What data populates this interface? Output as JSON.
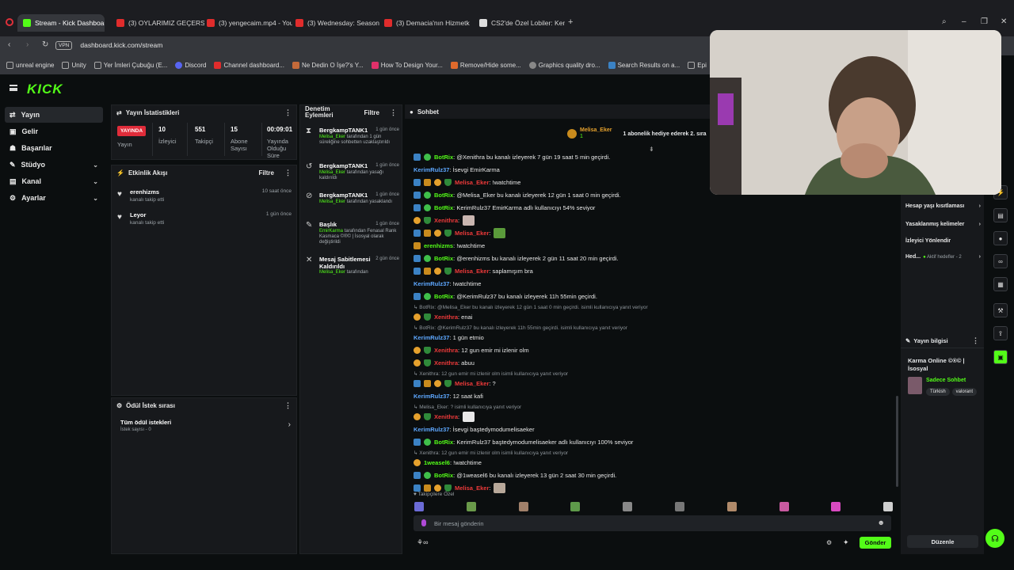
{
  "browser": {
    "tabs": [
      {
        "label": "Stream - Kick Dashboard",
        "active": true,
        "icon": "kick-icon"
      },
      {
        "label": "(3) OYLARIMIZ GEÇERSİZ",
        "icon": "youtube-icon"
      },
      {
        "label": "(3) yengecaim.mp4 - YouT",
        "icon": "youtube-icon"
      },
      {
        "label": "(3) Wednesday: Season 2",
        "icon": "youtube-icon"
      },
      {
        "label": "(3) Demacia'nın Hizmetkâ",
        "icon": "youtube-icon"
      },
      {
        "label": "CS2'de Özel Lobiler: Kend",
        "icon": "cs2-icon"
      }
    ],
    "vpn_label": "VPN",
    "url": "dashboard.kick.com/stream",
    "bookmarks": [
      "unreal engine",
      "Unity",
      "Yer İmleri Çubuğu (E...",
      "Discord",
      "Channel dashboard...",
      "Ne Dedin O İşe?'s Y...",
      "How To Design Your...",
      "Remove/Hide some...",
      "Graphics quality dro...",
      "Search Results on a...",
      "Epi"
    ]
  },
  "brand": {
    "logo": "KICK",
    "accent": "#53fc18"
  },
  "sidenav": {
    "items": [
      {
        "label": "Yayın",
        "icon": "broadcast-icon",
        "selected": true
      },
      {
        "label": "Gelir",
        "icon": "wallet-icon"
      },
      {
        "label": "Başarılar",
        "icon": "trophy-icon"
      },
      {
        "label": "Stüdyo",
        "icon": "studio-icon",
        "expandable": true
      },
      {
        "label": "Kanal",
        "icon": "channel-icon",
        "expandable": true
      },
      {
        "label": "Ayarlar",
        "icon": "gear-icon",
        "expandable": true
      }
    ]
  },
  "stats": {
    "title": "Yayın İstatistikleri",
    "live_badge": "YAYINDA",
    "live_label": "Yayın",
    "boxes": [
      {
        "value": "10",
        "label": "İzleyici"
      },
      {
        "value": "551",
        "label": "Takipçi"
      },
      {
        "value": "15",
        "label": "Abone Sayısı"
      },
      {
        "value": "00:09:01",
        "label": "Yayında Olduğu Süre"
      }
    ]
  },
  "activity": {
    "title": "Etkinlik Akışı",
    "filter": "Filtre",
    "items": [
      {
        "name": "erenhizms",
        "sub": "kanalı takip etti",
        "time": "10 saat önce"
      },
      {
        "name": "Leyor",
        "sub": "kanalı takip etti",
        "time": "1 gün önce"
      }
    ]
  },
  "rewards": {
    "title": "Ödül İstek sırası",
    "item_title": "Tüm ödül istekleri",
    "item_sub": "İstek sayısı - 0"
  },
  "moderation": {
    "title": "Denetim Eylemleri",
    "filter": "Filtre",
    "items": [
      {
        "title": "BergkampTANK1",
        "time": "1 gün önce",
        "user": "Melisa_Eker",
        "desc": "tarafından 1 gün süreliğine sohbetten uzaklaştırıldı",
        "icon": "timeout-icon"
      },
      {
        "title": "BergkampTANK1",
        "time": "1 gün önce",
        "user": "Melisa_Eker",
        "desc": "tarafından yasağı kaldırıldı",
        "icon": "unban-icon"
      },
      {
        "title": "BergkampTANK1",
        "time": "1 gün önce",
        "user": "Melisa_Eker",
        "desc": "tarafından yasaklandı",
        "icon": "ban-icon"
      },
      {
        "title": "Başlık",
        "time": "1 gün önce",
        "user": "EmirKarma",
        "desc": "tarafından Fenasal Rank Kasmaca ©®© | İsosyal olarak değiştirildi",
        "icon": "title-icon"
      },
      {
        "title": "Mesaj Sabitlemesi Kaldırıldı",
        "time": "2 gün önce",
        "user": "Melisa_Eker",
        "desc": "tarafından",
        "icon": "unpin-icon"
      }
    ]
  },
  "chat": {
    "title": "Sohbet",
    "pinned_user": "Melisa_Eker",
    "pinned_count": "1",
    "gift_text": "1 abonelik hediye ederek 2. sıra",
    "lines": [
      {
        "type": "msg",
        "badges": [
          "blue",
          "green"
        ],
        "name": "BotRix",
        "nc": "bot",
        "text": ": @Xenithra bu kanalı izleyerek 7 gün 19 saat 5 min geçirdi."
      },
      {
        "type": "msg",
        "badges": [],
        "name": "KerimRulz37",
        "nc": "blue",
        "text": ": İsevgi EmirKarma"
      },
      {
        "type": "msg",
        "badges": [
          "blue",
          "gold",
          "orange",
          "shield"
        ],
        "name": "Melisa_Eker",
        "nc": "red",
        "text": ": !watchtime"
      },
      {
        "type": "msg",
        "badges": [
          "blue",
          "green"
        ],
        "name": "BotRix",
        "nc": "bot",
        "text": ": @Melisa_Eker bu kanalı izleyerek 12 gün 1 saat 0 min geçirdi."
      },
      {
        "type": "msg",
        "badges": [
          "blue",
          "green"
        ],
        "name": "BotRix",
        "nc": "bot",
        "text": ": KerimRulz37 EmirKarma adlı kullanıcıyı 54% seviyor"
      },
      {
        "type": "msg",
        "badges": [
          "orange",
          "shield"
        ],
        "name": "Xenithra",
        "nc": "red",
        "text": ":",
        "emote": "#c9b6b0"
      },
      {
        "type": "msg",
        "badges": [
          "blue",
          "gold",
          "orange",
          "shield"
        ],
        "name": "Melisa_Eker",
        "nc": "red",
        "text": ":",
        "emote": "#5a9a3a"
      },
      {
        "type": "msg",
        "badges": [
          "gold"
        ],
        "name": "erenhizms",
        "nc": "green",
        "text": ": !watchtime"
      },
      {
        "type": "msg",
        "badges": [
          "blue",
          "green"
        ],
        "name": "BotRix",
        "nc": "bot",
        "text": ": @erenhizms bu kanalı izleyerek 2 gün 11 saat 20 min geçirdi."
      },
      {
        "type": "msg",
        "badges": [
          "blue",
          "gold",
          "orange",
          "shield"
        ],
        "name": "Melisa_Eker",
        "nc": "red",
        "text": ": saplamışım bra"
      },
      {
        "type": "msg",
        "badges": [],
        "name": "KerimRulz37",
        "nc": "blue",
        "text": ": !watchtime"
      },
      {
        "type": "msg",
        "badges": [
          "blue",
          "green"
        ],
        "name": "BotRix",
        "nc": "bot",
        "text": ": @KerimRulz37 bu kanalı izleyerek 11h 55min geçirdi."
      },
      {
        "type": "reply",
        "text": "BotRix: @Melisa_Eker bu kanalı izleyerek 12 gün 1 saat 0 min geçirdi. isimli kullanıcıya yanıt veriyor"
      },
      {
        "type": "msg",
        "badges": [
          "orange",
          "shield"
        ],
        "name": "Xenithra",
        "nc": "red",
        "text": ": enai"
      },
      {
        "type": "reply",
        "text": "BotRix: @KerimRulz37 bu kanalı izleyerek 11h 55min geçirdi. isimli kullanıcıya yanıt veriyor"
      },
      {
        "type": "msg",
        "badges": [],
        "name": "KerimRulz37",
        "nc": "blue",
        "text": ": 1 gün etmio"
      },
      {
        "type": "msg",
        "badges": [
          "orange",
          "shield"
        ],
        "name": "Xenithra",
        "nc": "red",
        "text": ": 12 gun emir mi izlenir olm"
      },
      {
        "type": "msg",
        "badges": [
          "orange",
          "shield"
        ],
        "name": "Xenithra",
        "nc": "red",
        "text": ": abuu"
      },
      {
        "type": "reply",
        "text": "Xenithra: 12 gun emir mi izlenir olm isimli kullanıcıya yanıt veriyor"
      },
      {
        "type": "msg",
        "badges": [
          "blue",
          "gold",
          "orange",
          "shield"
        ],
        "name": "Melisa_Eker",
        "nc": "red",
        "text": ": ?"
      },
      {
        "type": "msg",
        "badges": [],
        "name": "KerimRulz37",
        "nc": "blue",
        "text": ": 12 saat kafi"
      },
      {
        "type": "reply",
        "text": "Melisa_Eker: ? isimli kullanıcıya yanıt veriyor"
      },
      {
        "type": "msg",
        "badges": [
          "orange",
          "shield"
        ],
        "name": "Xenithra",
        "nc": "red",
        "text": ":",
        "emote": "#e8e8e8"
      },
      {
        "type": "msg",
        "badges": [],
        "name": "KerimRulz37",
        "nc": "blue",
        "text": ": İsevgi baştedymodumelisaeker"
      },
      {
        "type": "msg",
        "badges": [
          "blue",
          "green"
        ],
        "name": "BotRix",
        "nc": "bot",
        "text": ": KerimRulz37 baştedymodumelisaeker adlı kullanıcıyı 100% seviyor"
      },
      {
        "type": "reply",
        "text": "Xenithra: 12 gun emir mi izlenir olm isimli kullanıcıya yanıt veriyor"
      },
      {
        "type": "msg",
        "badges": [
          "orange"
        ],
        "name": "1weasel6",
        "nc": "green",
        "text": ": !watchtime"
      },
      {
        "type": "msg",
        "badges": [
          "blue",
          "green"
        ],
        "name": "BotRix",
        "nc": "bot",
        "text": ": @1weasel6 bu kanalı izleyerek 13 gün 2 saat 30 min geçirdi."
      },
      {
        "type": "msg",
        "badges": [
          "blue",
          "gold",
          "orange",
          "shield"
        ],
        "name": "Melisa_Eker",
        "nc": "red",
        "text": ":",
        "emote": "#b8a89a"
      }
    ],
    "followers_only": "Takipçilere Özel",
    "input_placeholder": "Bir mesaj gönderin",
    "send_label": "Gönder",
    "emote_colors": [
      "#6b6bd6",
      "#6a9a4a",
      "#a0806a",
      "#5e9a4a",
      "#888",
      "#777",
      "#b08a6a",
      "#c85aa0",
      "#d84ac0",
      "#cfcfcf"
    ]
  },
  "right_panel": {
    "menu": [
      {
        "label": "Hesap yaşı kısıtlaması"
      },
      {
        "label": "Yasaklanmış kelimeler"
      },
      {
        "label": "İzleyici Yönlendir"
      },
      {
        "label": "Hed...",
        "extra": "Aktif hedefler - 2"
      }
    ],
    "stream_info_title": "Yayın bilgisi",
    "stream_title": "Karma Online ©®© | İsosyal",
    "category": "Sadece Sohbet",
    "tags": [
      "Türkish",
      "valorant"
    ],
    "edit_label": "Düzenle"
  }
}
